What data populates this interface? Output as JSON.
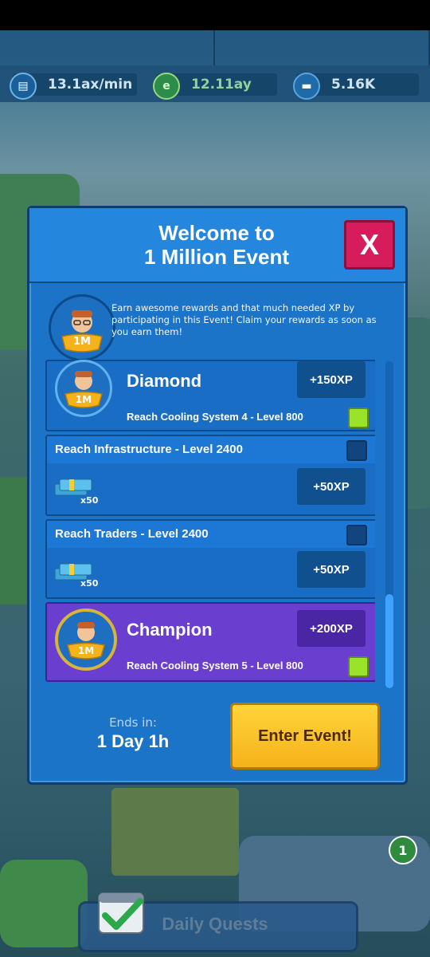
{
  "resources": [
    {
      "icon": "stock-ticker-icon",
      "value": "13.1ax/min"
    },
    {
      "icon": "eco-coin-icon",
      "value": "12.11ay"
    },
    {
      "icon": "cash-bundle-icon",
      "value": "5.16K"
    }
  ],
  "modal": {
    "title_line1": "Welcome to",
    "title_line2": "1 Million Event",
    "close_label": "X",
    "intro": "Earn awesome rewards and that much needed XP by participating in this Event! Claim your rewards as soon as you earn them!",
    "badge_label": "1M"
  },
  "milestones": [
    {
      "type": "tier",
      "name": "Diamond",
      "xp": "+150XP",
      "requirement": "Reach Cooling System 4 - Level 800",
      "badge": "1M",
      "completed": true
    },
    {
      "type": "task",
      "title": "Reach Infrastructure - Level 2400",
      "reward_qty": "x50",
      "xp": "+50XP",
      "completed": false
    },
    {
      "type": "task",
      "title": "Reach Traders - Level 2400",
      "reward_qty": "x50",
      "xp": "+50XP",
      "completed": false
    },
    {
      "type": "tier",
      "name": "Champion",
      "xp": "+200XP",
      "requirement": "Reach Cooling System 5 - Level 800",
      "badge": "1M",
      "completed": true
    }
  ],
  "footer": {
    "ends_label": "Ends in:",
    "ends_value": "1 Day 1h",
    "enter_label": "Enter Event!"
  },
  "bottom": {
    "daily_quests_label": "Daily Quests",
    "notification_count": "1"
  },
  "colors": {
    "modal_blue": "#1c74c8",
    "close_red": "#d61c5a",
    "enter_yellow": "#ffc62a",
    "champion_purple": "#6a3fcf",
    "check_green": "#9be22a"
  }
}
